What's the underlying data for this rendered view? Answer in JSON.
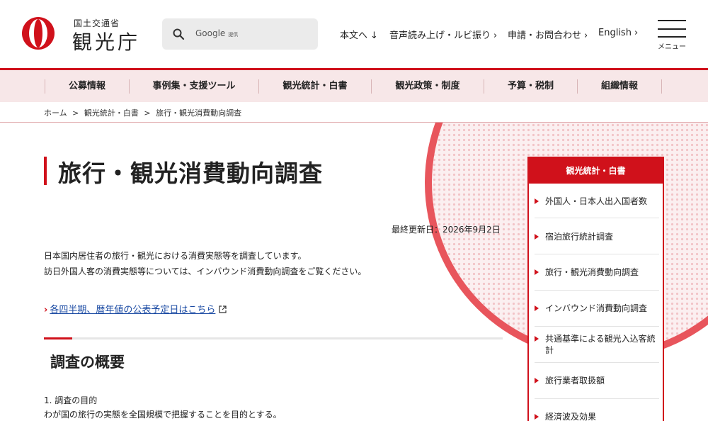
{
  "header": {
    "logo_sub": "国土交通省",
    "logo_main": "観光庁",
    "search_placeholder": "Google",
    "search_provided": "提供",
    "links": [
      {
        "label": "本文へ",
        "arrow": "↓"
      },
      {
        "label": "音声読み上げ・ルビ振り",
        "arrow": "›"
      },
      {
        "label": "申請・お問合わせ",
        "arrow": "›"
      },
      {
        "label": "English",
        "arrow": "›"
      }
    ],
    "menu_label": "メニュー"
  },
  "gnav": [
    "公募情報",
    "事例集・支援ツール",
    "観光統計・白書",
    "観光政策・制度",
    "予算・税制",
    "組織情報"
  ],
  "breadcrumb": [
    "ホーム",
    ">",
    "観光統計・白書",
    ">",
    "旅行・観光消費動向調査"
  ],
  "main": {
    "title": "旅行・観光消費動向調査",
    "updated": "最終更新日：2026年9月2日",
    "intro_1": "日本国内居住者の旅行・観光における消費実態等を調査しています。",
    "intro_2": "訪日外国人客の消費実態等については、インバウンド消費動向調査をご覧ください。",
    "schedule_link": "各四半期、暦年値の公表予定日はこちら",
    "section_title": "調査の概要",
    "purpose_heading": "1. 調査の目的",
    "purpose_text": "わが国の旅行の実態を全国規模で把握することを目的とする。"
  },
  "side": {
    "heading": "観光統計・白書",
    "items": [
      "外国人・日本人出入国者数",
      "宿泊旅行統計調査",
      "旅行・観光消費動向調査",
      "インバウンド消費動向調査",
      "共通基準による観光入込客統計",
      "旅行業者取扱額",
      "経済波及効果"
    ]
  },
  "colors": {
    "accent": "#d0111b",
    "nav_bg": "#f7e7e8",
    "link": "#1a4aa3"
  }
}
